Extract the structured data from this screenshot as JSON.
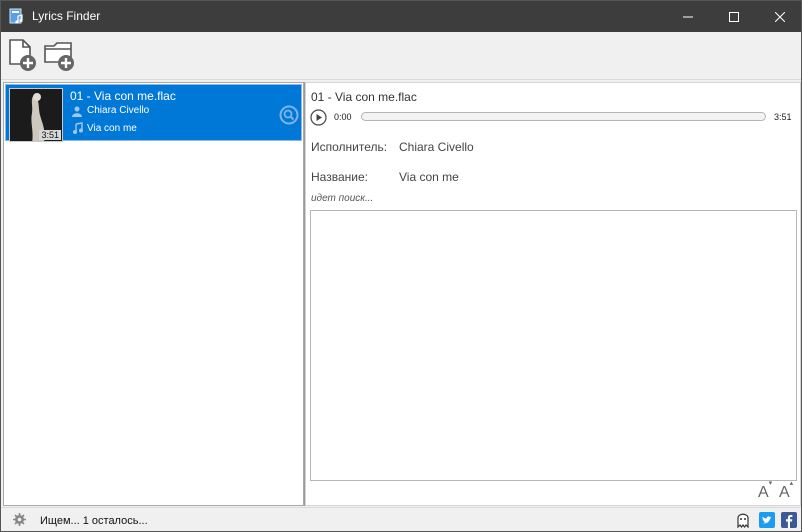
{
  "window": {
    "title": "Lyrics Finder",
    "accent_color": "#0078d7",
    "titlebar_color": "#3d3d3d"
  },
  "toolbar": {
    "add_file_icon": "add-file-icon",
    "add_folder_icon": "add-folder-icon"
  },
  "tracks": [
    {
      "title": "01 - Via con me.flac",
      "artist": "Chiara Civello",
      "song": "Via con me",
      "duration": "3:51",
      "cover_text": "CHIARA CIVELLO"
    }
  ],
  "player": {
    "file_name": "01 - Via con me.flac",
    "current_time": "0:00",
    "total_time": "3:51",
    "progress_fraction": 0
  },
  "details": {
    "artist_label": "Исполнитель:",
    "artist_value": "Chiara Civello",
    "title_label": "Название:",
    "title_value": "Via con me",
    "search_status": "идет поиск...",
    "lyrics": ""
  },
  "statusbar": {
    "text": "Ищем... 1 осталось..."
  }
}
